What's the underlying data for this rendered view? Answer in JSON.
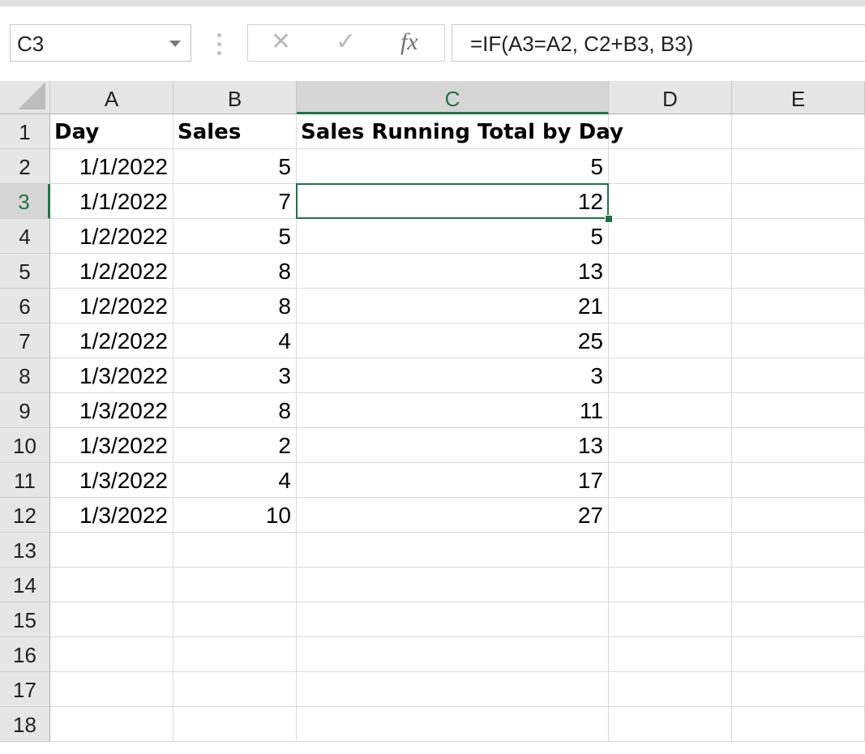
{
  "formula_bar": {
    "name_box": "C3",
    "formula": "=IF(A3=A2, C2+B3, B3)",
    "cancel_glyph": "✕",
    "enter_glyph": "✓",
    "fx_glyph": "fx"
  },
  "columns": [
    "A",
    "B",
    "C",
    "D",
    "E"
  ],
  "rows": [
    "1",
    "2",
    "3",
    "4",
    "5",
    "6",
    "7",
    "8",
    "9",
    "10",
    "11",
    "12",
    "13",
    "14",
    "15",
    "16",
    "17",
    "18"
  ],
  "sheet": {
    "header": [
      "Day",
      "Sales",
      "Sales Running Total by Day"
    ],
    "data": [
      [
        "1/1/2022",
        "5",
        "5"
      ],
      [
        "1/1/2022",
        "7",
        "12"
      ],
      [
        "1/2/2022",
        "5",
        "5"
      ],
      [
        "1/2/2022",
        "8",
        "13"
      ],
      [
        "1/2/2022",
        "8",
        "21"
      ],
      [
        "1/2/2022",
        "4",
        "25"
      ],
      [
        "1/3/2022",
        "3",
        "3"
      ],
      [
        "1/3/2022",
        "8",
        "11"
      ],
      [
        "1/3/2022",
        "2",
        "13"
      ],
      [
        "1/3/2022",
        "4",
        "17"
      ],
      [
        "1/3/2022",
        "10",
        "27"
      ]
    ]
  },
  "active_cell": "C3",
  "colors": {
    "accent": "#217346",
    "header_bg": "#e6e6e6",
    "gridline": "#d9d9d9"
  }
}
